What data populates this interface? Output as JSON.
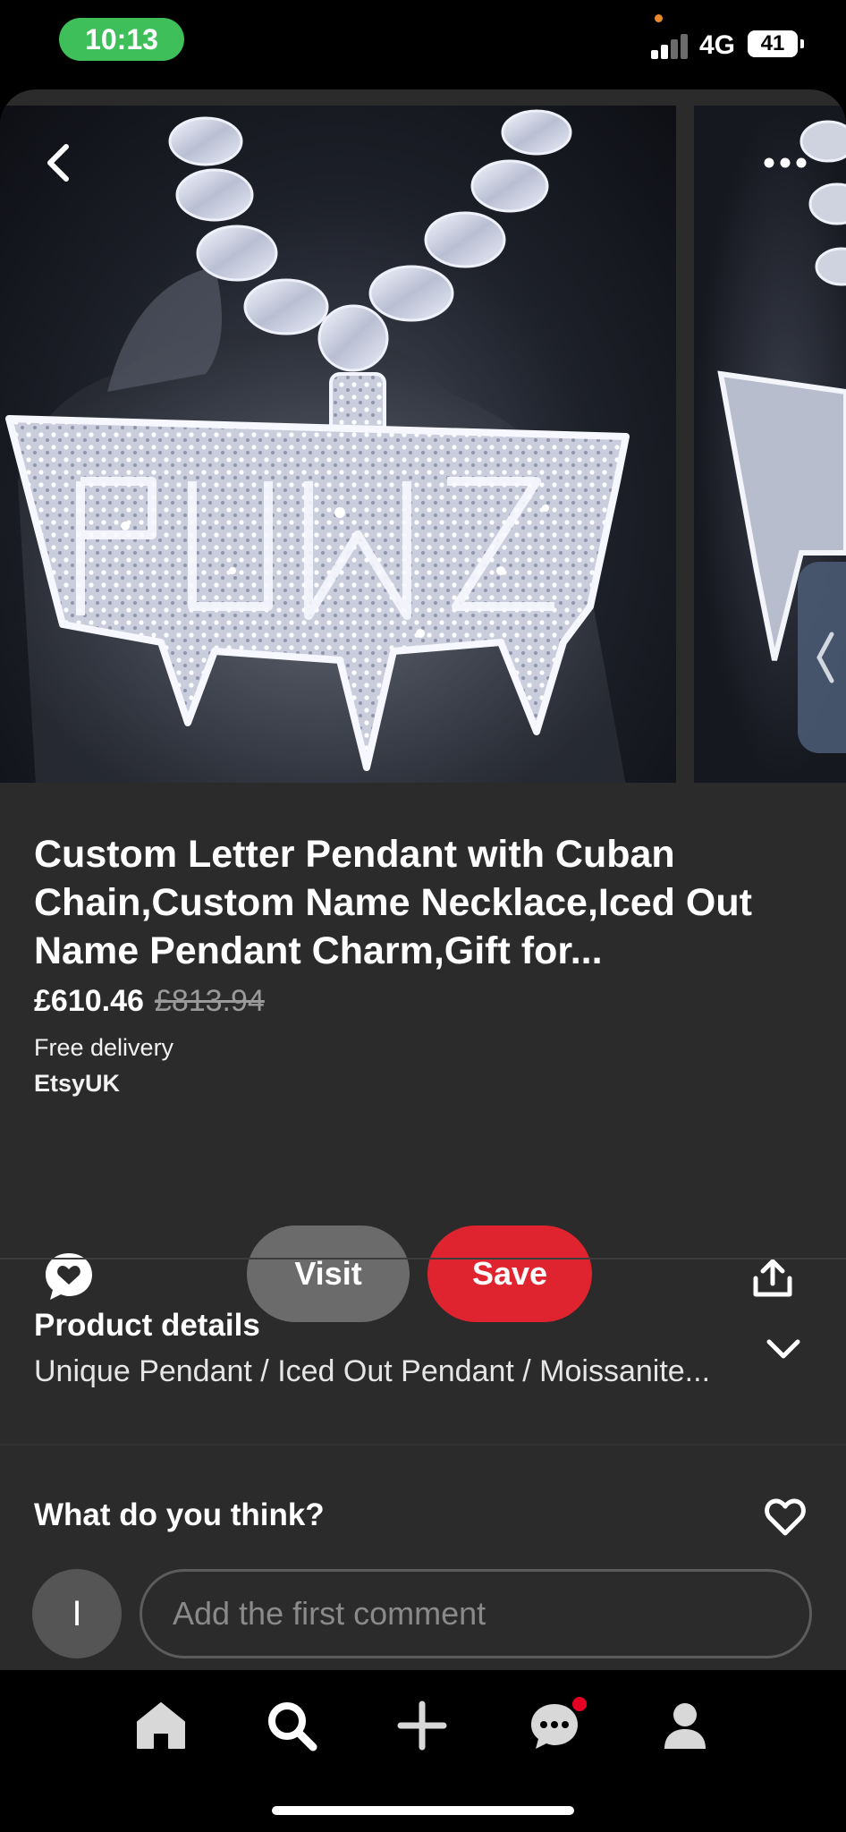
{
  "status_bar": {
    "time": "10:13",
    "network": "4G",
    "battery": "41"
  },
  "pin": {
    "image_alt": "Iced out custom letter pendant on Cuban chain",
    "title": "Custom Letter Pendant with Cuban Chain,Custom Name Necklace,Iced Out Name Pendant Charm,Gift for...",
    "price": "£610.46",
    "original_price": "£813.94",
    "delivery": "Free delivery",
    "store": "EtsyUK"
  },
  "actions": {
    "visit_label": "Visit",
    "save_label": "Save",
    "save_color": "#e0242f"
  },
  "details": {
    "title": "Product details",
    "summary": "Unique Pendant / Iced Out Pendant / Moissanite..."
  },
  "comments": {
    "title": "What do you think?",
    "avatar_initial": "I",
    "placeholder": "Add the first comment"
  },
  "icons": {
    "back": "chevron-left-icon",
    "more": "more-horizontal-icon",
    "comment": "speech-bubble-heart-icon",
    "share": "share-upload-icon",
    "expand": "chevron-down-icon",
    "react": "heart-outline-icon"
  },
  "nav": {
    "items": [
      "home-icon",
      "search-icon",
      "create-plus-icon",
      "messages-icon",
      "profile-icon"
    ],
    "active": "search-icon",
    "notification_color": "#e60023"
  }
}
